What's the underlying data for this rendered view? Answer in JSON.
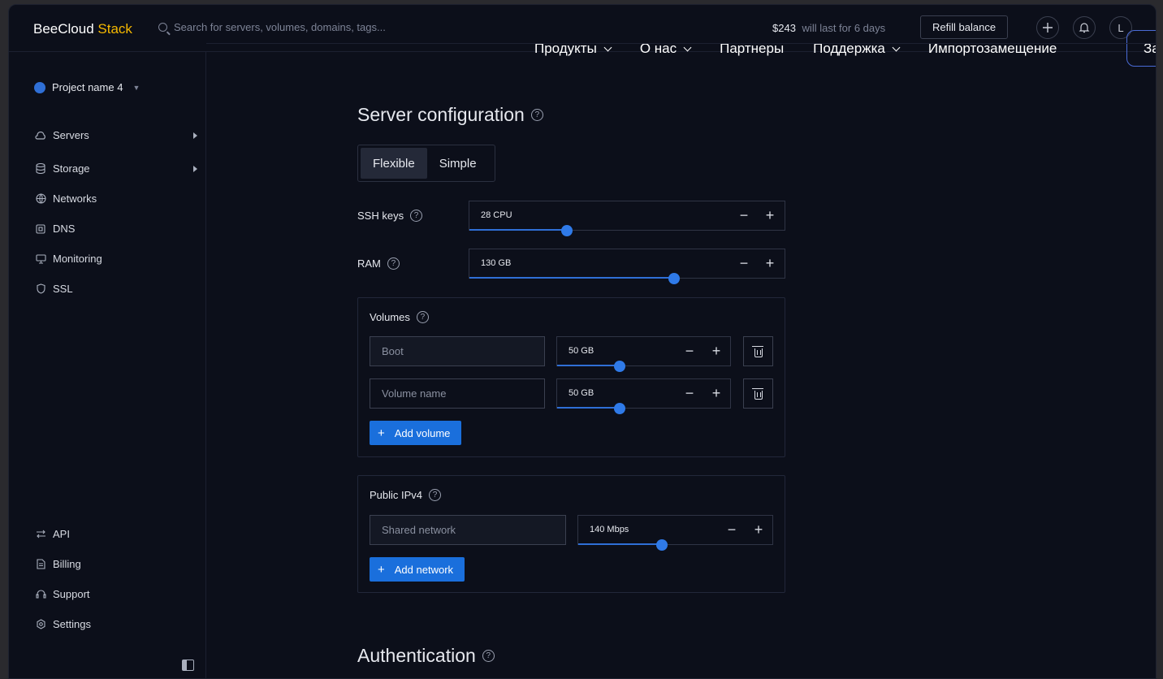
{
  "app": {
    "brand": "BeeCloud",
    "brand_accent": "Stack"
  },
  "search": {
    "placeholder": "Search for servers, volumes, domains, tags..."
  },
  "header": {
    "balance": "$243",
    "balance_note": "will last for 6 days",
    "refill_label": "Refill balance",
    "avatar_initial": "L"
  },
  "overlay_nav": {
    "items": [
      "Продукты",
      "О нас",
      "Партнеры",
      "Поддержка",
      "Импортозамещение"
    ],
    "cta_label": "За"
  },
  "sidebar": {
    "project_name": "Project name 4",
    "items": [
      {
        "label": "Servers",
        "icon": "cloud-icon"
      },
      {
        "label": "Storage",
        "icon": "database-icon"
      },
      {
        "label": "Networks",
        "icon": "globe-icon"
      },
      {
        "label": "DNS",
        "icon": "dns-icon"
      },
      {
        "label": "Monitoring",
        "icon": "monitor-icon"
      },
      {
        "label": "SSL",
        "icon": "shield-icon"
      }
    ],
    "bottom_items": [
      {
        "label": "API",
        "icon": "arrows-icon"
      },
      {
        "label": "Billing",
        "icon": "document-icon"
      },
      {
        "label": "Support",
        "icon": "headset-icon"
      },
      {
        "label": "Settings",
        "icon": "gear-icon"
      }
    ]
  },
  "main": {
    "section_title": "Server configuration",
    "mode_options": [
      "Flexible",
      "Simple"
    ],
    "active_mode": "Flexible",
    "ssh": {
      "label": "SSH keys",
      "value": "28 CPU",
      "fraction": 0.31
    },
    "ram": {
      "label": "RAM",
      "value": "130 GB",
      "fraction": 0.65
    },
    "volumes": {
      "title": "Volumes",
      "rows": [
        {
          "name_value": "Boot",
          "placeholder": "",
          "size": "50 GB",
          "fraction": 0.36
        },
        {
          "name_value": "",
          "placeholder": "Volume name",
          "size": "50 GB",
          "fraction": 0.36
        }
      ],
      "add_label": "Add volume"
    },
    "ipv4": {
      "title": "Public IPv4",
      "network_value": "Shared network",
      "bandwidth": "140 Mbps",
      "fraction": 0.43,
      "add_label": "Add network"
    },
    "auth_title": "Authentication"
  },
  "colors": {
    "accent": "#1a6fdc",
    "brand_accent": "#f5b800",
    "background": "#0c0f1a"
  }
}
